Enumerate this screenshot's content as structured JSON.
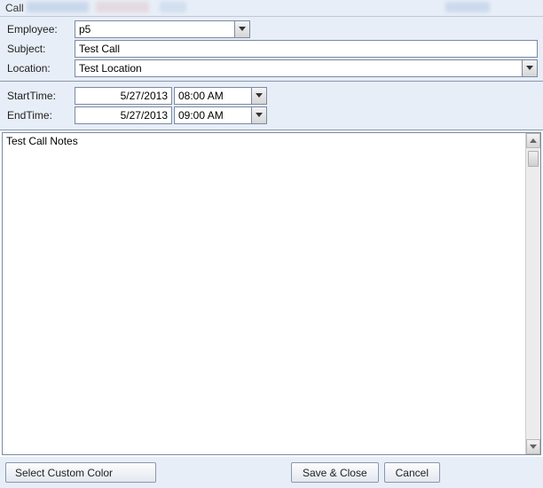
{
  "title": "Call",
  "form": {
    "employee_label": "Employee:",
    "employee_value": "p5",
    "subject_label": "Subject:",
    "subject_value": "Test Call",
    "location_label": "Location:",
    "location_value": "Test Location"
  },
  "times": {
    "start_label": "StartTime:",
    "start_date": "5/27/2013",
    "start_time": "08:00 AM",
    "end_label": "EndTime:",
    "end_date": "5/27/2013",
    "end_time": "09:00 AM"
  },
  "notes": {
    "value": "Test Call Notes"
  },
  "buttons": {
    "select_color": "Select Custom Color",
    "save_close": "Save & Close",
    "cancel": "Cancel"
  }
}
